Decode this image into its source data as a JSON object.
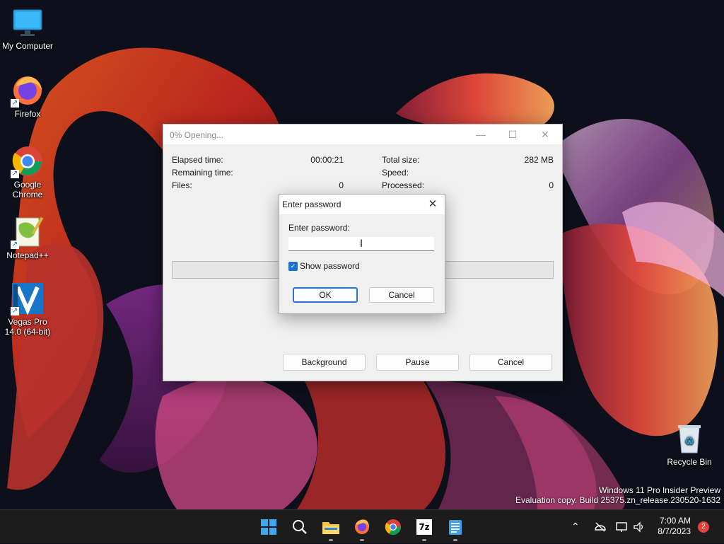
{
  "desktop": {
    "icons": [
      {
        "label": "My Computer",
        "icon": "monitor-icon"
      },
      {
        "label": "Firefox",
        "icon": "firefox-icon"
      },
      {
        "label": "Google Chrome",
        "icon": "chrome-icon"
      },
      {
        "label": "Notepad++",
        "icon": "notepadpp-icon"
      },
      {
        "label": "Vegas Pro 14.0 (64-bit)",
        "icon": "vegas-icon"
      },
      {
        "label": "Recycle Bin",
        "icon": "recycle-bin-icon"
      }
    ]
  },
  "progress_window": {
    "title": "0% Opening...",
    "elapsed_label": "Elapsed time:",
    "elapsed_value": "00:00:21",
    "remaining_label": "Remaining time:",
    "remaining_value": "",
    "files_label": "Files:",
    "files_value": "0",
    "total_size_label": "Total size:",
    "total_size_value": "282 MB",
    "speed_label": "Speed:",
    "speed_value": "",
    "processed_label": "Processed:",
    "processed_value": "0",
    "progress": 0,
    "buttons": {
      "background": "Background",
      "pause": "Pause",
      "cancel": "Cancel"
    }
  },
  "password_dialog": {
    "title": "Enter password",
    "field_label": "Enter password:",
    "field_value": "",
    "show_password_label": "Show password",
    "show_password_checked": true,
    "ok_label": "OK",
    "cancel_label": "Cancel"
  },
  "watermark": {
    "line1": "Windows 11 Pro Insider Preview",
    "line2": "Evaluation copy. Build 25375.zn_release.230520-1632"
  },
  "taskbar": {
    "apps": [
      "start-icon",
      "search-icon",
      "file-explorer-icon",
      "firefox-icon",
      "chrome-icon",
      "7zip-icon",
      "notepad-icon"
    ],
    "time": "7:00 AM",
    "date": "8/7/2023",
    "notification_count": "2",
    "sevenzip_label": "7z"
  },
  "colors": {
    "accent": "#1f6fcf",
    "taskbar": "#1c1c1c",
    "badge": "#e0413d"
  }
}
